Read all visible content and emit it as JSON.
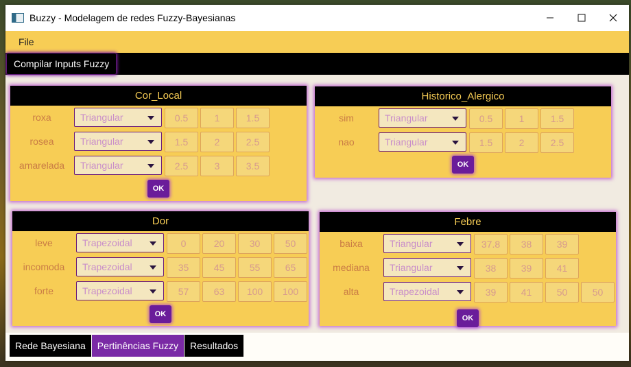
{
  "window": {
    "title": "Buzzy - Modelagem de redes Fuzzy-Bayesianas"
  },
  "menu": {
    "file": "File"
  },
  "toolbar": {
    "compile": "Compilar Inputs Fuzzy"
  },
  "panels": [
    {
      "title": "Cor_Local",
      "rows": [
        {
          "label": "roxa",
          "type": "Triangular",
          "values": [
            "0.5",
            "1",
            "1.5"
          ]
        },
        {
          "label": "rosea",
          "type": "Triangular",
          "values": [
            "1.5",
            "2",
            "2.5"
          ]
        },
        {
          "label": "amarelada",
          "type": "Triangular",
          "values": [
            "2.5",
            "3",
            "3.5"
          ]
        }
      ],
      "ok": "OK"
    },
    {
      "title": "Historico_Alergico",
      "rows": [
        {
          "label": "sim",
          "type": "Triangular",
          "values": [
            "0.5",
            "1",
            "1.5"
          ]
        },
        {
          "label": "nao",
          "type": "Triangular",
          "values": [
            "1.5",
            "2",
            "2.5"
          ]
        }
      ],
      "ok": "OK"
    },
    {
      "title": "Dor",
      "rows": [
        {
          "label": "leve",
          "type": "Trapezoidal",
          "values": [
            "0",
            "20",
            "30",
            "50"
          ]
        },
        {
          "label": "incomoda",
          "type": "Trapezoidal",
          "values": [
            "35",
            "45",
            "55",
            "65"
          ]
        },
        {
          "label": "forte",
          "type": "Trapezoidal",
          "values": [
            "57",
            "63",
            "100",
            "100"
          ]
        }
      ],
      "ok": "OK"
    },
    {
      "title": "Febre",
      "rows": [
        {
          "label": "baixa",
          "type": "Triangular",
          "values": [
            "37.8",
            "38",
            "39"
          ]
        },
        {
          "label": "mediana",
          "type": "Triangular",
          "values": [
            "38",
            "39",
            "41"
          ]
        },
        {
          "label": "alta",
          "type": "Trapezoidal",
          "values": [
            "39",
            "41",
            "50",
            "50"
          ]
        }
      ],
      "ok": "OK"
    }
  ],
  "tabs": [
    {
      "label": "Rede Bayesiana"
    },
    {
      "label": "Pertinências Fuzzy"
    },
    {
      "label": "Resultados"
    }
  ],
  "colors": {
    "accent_yellow": "#f7cd55",
    "accent_purple": "#7a2aa5",
    "header_black": "#000000"
  }
}
